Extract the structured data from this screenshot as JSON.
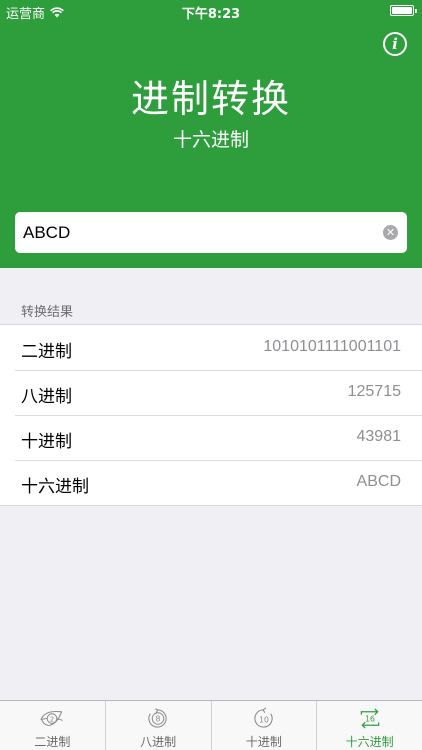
{
  "status": {
    "carrier": "运营商",
    "time": "下午8:23"
  },
  "header": {
    "title": "进制转换",
    "subtitle": "十六进制"
  },
  "input": {
    "value": "ABCD"
  },
  "results": {
    "section_label": "转换结果",
    "rows": [
      {
        "label": "二进制",
        "value": "1010101111001101"
      },
      {
        "label": "八进制",
        "value": "125715"
      },
      {
        "label": "十进制",
        "value": "43981"
      },
      {
        "label": "十六进制",
        "value": "ABCD"
      }
    ]
  },
  "tabs": [
    {
      "label": "二进制",
      "badge": "2",
      "icon": "binary-icon"
    },
    {
      "label": "八进制",
      "badge": "8",
      "icon": "octal-icon"
    },
    {
      "label": "十进制",
      "badge": "10",
      "icon": "decimal-icon"
    },
    {
      "label": "十六进制",
      "badge": "16",
      "icon": "hex-icon"
    }
  ],
  "colors": {
    "accent": "#2e9e3d",
    "background": "#efeff4"
  }
}
